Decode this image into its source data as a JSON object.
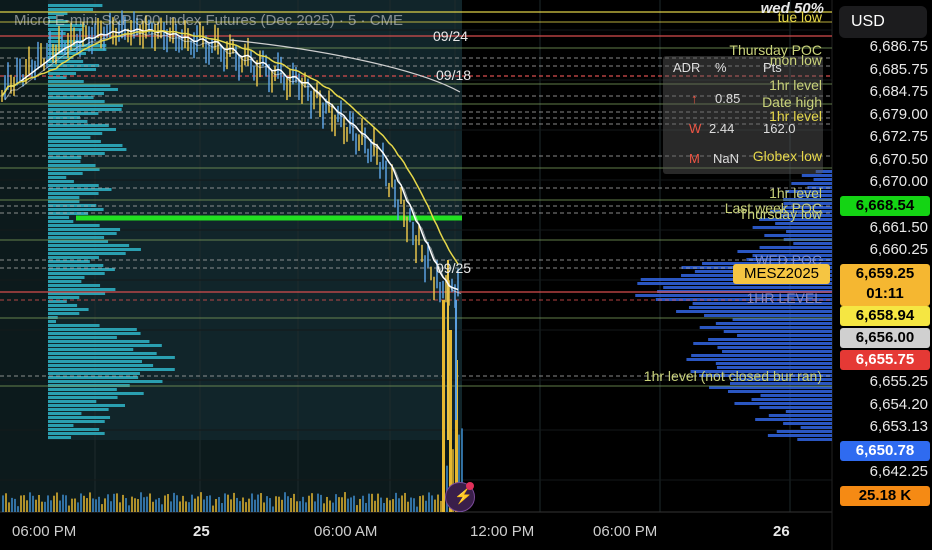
{
  "title": "Micro E-mini S&P 500 Index Futures (Dec 2025) · 5 · CME",
  "currency": "USD",
  "symbol_tag": "MESZ2025",
  "adr_panel": {
    "headers": [
      "ADR",
      "%",
      "Pts"
    ],
    "rows": [
      {
        "marker": "↑",
        "pct": "0.85",
        "pts": ""
      },
      {
        "marker": "W",
        "pct": "2.44",
        "pts": "162.0"
      },
      {
        "marker": "M",
        "pct": "NaN",
        "pts": ""
      }
    ]
  },
  "price_axis": [
    "6,686.75",
    "6,685.75",
    "6,684.75",
    "6,679.00",
    "6,672.75",
    "6,670.50",
    "6,670.00",
    "6,661.50",
    "6,660.25",
    "6,655.25",
    "6,654.20",
    "6,653.13",
    "6,642.25"
  ],
  "price_tags": [
    {
      "label": "6,668.54",
      "bg": "#14d414",
      "fg": "#000"
    },
    {
      "label": "6,659.25",
      "sub": "01:11",
      "bg": "#f5b731",
      "fg": "#000"
    },
    {
      "label": "6,658.94",
      "bg": "#f5e642",
      "fg": "#000"
    },
    {
      "label": "6,656.00",
      "bg": "#d0d0d0",
      "fg": "#000"
    },
    {
      "label": "6,655.75",
      "bg": "#e53935",
      "fg": "#fff"
    },
    {
      "label": "6,650.78",
      "bg": "#2f6bf0",
      "fg": "#fff"
    },
    {
      "label": "25.18 K",
      "bg": "#f58a14",
      "fg": "#000"
    }
  ],
  "time_axis": [
    "06:00 PM",
    "25",
    "06:00 AM",
    "12:00 PM",
    "06:00 PM",
    "26"
  ],
  "level_labels": [
    {
      "text": "wed 50%",
      "color": "#e8e8e8"
    },
    {
      "text": "tue low",
      "color": "#e6d84a"
    },
    {
      "text": "09/24",
      "color": "#e8e8e8"
    },
    {
      "text": "Thursday POC",
      "color": "#c9d27a"
    },
    {
      "text": "mon low",
      "color": "#c9d27a"
    },
    {
      "text": "09/18",
      "color": "#e8e8e8"
    },
    {
      "text": "1hr level",
      "color": "#c9d27a"
    },
    {
      "text": "Date high",
      "color": "#c9d27a"
    },
    {
      "text": "1hr level",
      "color": "#e6d84a"
    },
    {
      "text": "Globex low",
      "color": "#e6d84a"
    },
    {
      "text": "1hr level",
      "color": "#c9d27a"
    },
    {
      "text": "Last week POC",
      "color": "#c9d27a"
    },
    {
      "text": "Thursday low",
      "color": "#c9d27a"
    },
    {
      "text": "WED POC",
      "color": "#7a8bd0"
    },
    {
      "text": "09/25",
      "color": "#e8e8e8"
    },
    {
      "text": "1HR LEVEL",
      "color": "#8a8ac0"
    },
    {
      "text": "1hr level (not closed bur ran)",
      "color": "#c9d27a"
    }
  ],
  "colors": {
    "bg": "#000000",
    "volume_profile_left": "#2fb5c8",
    "volume_profile_right": "#2f5fd6",
    "ma_white": "#ffffff",
    "ma_yellow": "#e6d84a",
    "poc_green": "#22e022"
  }
}
